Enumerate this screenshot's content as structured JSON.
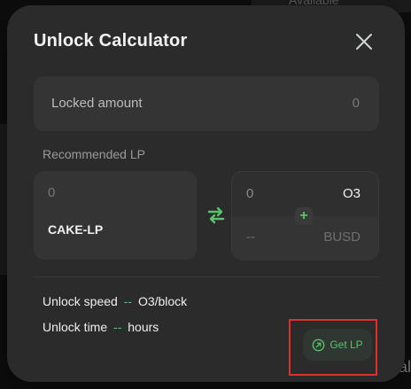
{
  "background": {
    "available_label": "Available",
    "right_fragment": "tal"
  },
  "modal": {
    "title": "Unlock Calculator",
    "locked": {
      "label": "Locked amount",
      "value": "0"
    },
    "recommended_label": "Recommended LP",
    "lp": {
      "value": "0",
      "token": "CAKE-LP"
    },
    "pair": [
      {
        "value": "0",
        "token": "O3"
      },
      {
        "value": "--",
        "token": "BUSD"
      }
    ],
    "stats": {
      "speed_label": "Unlock speed",
      "speed_value": "--",
      "speed_unit": "O3/block",
      "time_label": "Unlock time",
      "time_value": "--",
      "time_unit": "hours"
    },
    "get_lp_label": "Get LP"
  },
  "colors": {
    "accent_green": "#57c46a",
    "highlight_red": "#e0302a",
    "modal_bg": "#2b2b2b"
  },
  "icons": [
    "close-icon",
    "swap-icon",
    "plus-icon",
    "arrow-up-right-circle-icon"
  ]
}
